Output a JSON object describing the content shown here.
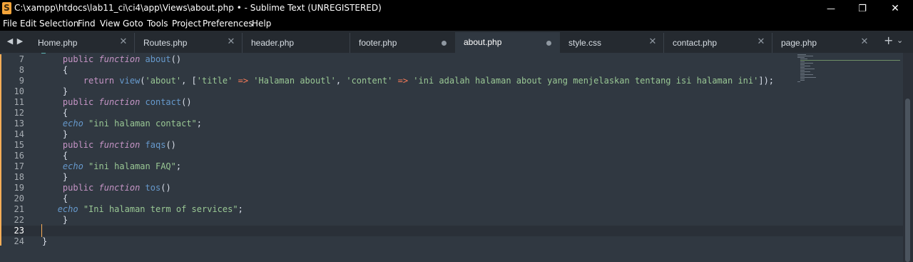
{
  "window": {
    "title": "C:\\xampp\\htdocs\\lab11_ci\\ci4\\app\\Views\\about.php • - Sublime Text (UNREGISTERED)",
    "app_icon": "sublime-text-icon",
    "controls": {
      "minimize": "—",
      "maximize": "❐",
      "close": "✕"
    }
  },
  "menu": [
    "File",
    "Edit",
    "Selection",
    "Find",
    "View",
    "Goto",
    "Tools",
    "Project",
    "Preferences",
    "Help"
  ],
  "tabs": [
    {
      "label": "Home.php",
      "state": "close",
      "active": false
    },
    {
      "label": "Routes.php",
      "state": "close",
      "active": false
    },
    {
      "label": "header.php",
      "state": "none",
      "active": false
    },
    {
      "label": "footer.php",
      "state": "dirty",
      "active": false
    },
    {
      "label": "about.php",
      "state": "dirty",
      "active": true
    },
    {
      "label": "style.css",
      "state": "close",
      "active": false
    },
    {
      "label": "contact.php",
      "state": "close",
      "active": false
    },
    {
      "label": "page.php",
      "state": "close",
      "active": false
    }
  ],
  "tab_icons": {
    "prev": "◀",
    "next": "▶",
    "close": "✕",
    "new_tab": "+",
    "tab_list": "⌄"
  },
  "editor": {
    "current_line": 23,
    "lines": [
      {
        "n": "7",
        "tokens": [
          [
            "    ",
            "pun"
          ],
          [
            "public",
            "kw"
          ],
          [
            " ",
            "pun"
          ],
          [
            "function",
            "fn"
          ],
          [
            " ",
            "pun"
          ],
          [
            "about",
            "name"
          ],
          [
            "()",
            "pun"
          ]
        ]
      },
      {
        "n": "8",
        "tokens": [
          [
            "    {",
            "pun"
          ]
        ]
      },
      {
        "n": "9",
        "tokens": [
          [
            "        ",
            "pun"
          ],
          [
            "return",
            "kw"
          ],
          [
            " ",
            "pun"
          ],
          [
            "view",
            "name"
          ],
          [
            "(",
            "pun"
          ],
          [
            "'about'",
            "str"
          ],
          [
            ", [",
            "pun"
          ],
          [
            "'title'",
            "str"
          ],
          [
            " ",
            "pun"
          ],
          [
            "=>",
            "op"
          ],
          [
            " ",
            "pun"
          ],
          [
            "'Halaman aboutl'",
            "str"
          ],
          [
            ", ",
            "pun"
          ],
          [
            "'content'",
            "str"
          ],
          [
            " ",
            "pun"
          ],
          [
            "=>",
            "op"
          ],
          [
            " ",
            "pun"
          ],
          [
            "'ini adalah halaman about yang menjelaskan tentang isi halaman ini'",
            "str"
          ],
          [
            "]);",
            "pun"
          ]
        ]
      },
      {
        "n": "10",
        "tokens": [
          [
            "    }",
            "pun"
          ]
        ]
      },
      {
        "n": "11",
        "tokens": [
          [
            "    ",
            "pun"
          ],
          [
            "public",
            "kw"
          ],
          [
            " ",
            "pun"
          ],
          [
            "function",
            "fn"
          ],
          [
            " ",
            "pun"
          ],
          [
            "contact",
            "name"
          ],
          [
            "()",
            "pun"
          ]
        ]
      },
      {
        "n": "12",
        "tokens": [
          [
            "    {",
            "pun"
          ]
        ]
      },
      {
        "n": "13",
        "tokens": [
          [
            "    ",
            "pun"
          ],
          [
            "echo",
            "echo"
          ],
          [
            " ",
            "pun"
          ],
          [
            "\"ini halaman contact\"",
            "str"
          ],
          [
            ";",
            "pun"
          ]
        ]
      },
      {
        "n": "14",
        "tokens": [
          [
            "    }",
            "pun"
          ]
        ]
      },
      {
        "n": "15",
        "tokens": [
          [
            "    ",
            "pun"
          ],
          [
            "public",
            "kw"
          ],
          [
            " ",
            "pun"
          ],
          [
            "function",
            "fn"
          ],
          [
            " ",
            "pun"
          ],
          [
            "faqs",
            "name"
          ],
          [
            "()",
            "pun"
          ]
        ]
      },
      {
        "n": "16",
        "tokens": [
          [
            "    {",
            "pun"
          ]
        ]
      },
      {
        "n": "17",
        "tokens": [
          [
            "    ",
            "pun"
          ],
          [
            "echo",
            "echo"
          ],
          [
            " ",
            "pun"
          ],
          [
            "\"ini halaman FAQ\"",
            "str"
          ],
          [
            ";",
            "pun"
          ]
        ]
      },
      {
        "n": "18",
        "tokens": [
          [
            "    }",
            "pun"
          ]
        ]
      },
      {
        "n": "19",
        "tokens": [
          [
            "    ",
            "pun"
          ],
          [
            "public",
            "kw"
          ],
          [
            " ",
            "pun"
          ],
          [
            "function",
            "fn"
          ],
          [
            " ",
            "pun"
          ],
          [
            "tos",
            "name"
          ],
          [
            "()",
            "pun"
          ]
        ]
      },
      {
        "n": "20",
        "tokens": [
          [
            "    {",
            "pun"
          ]
        ]
      },
      {
        "n": "21",
        "tokens": [
          [
            "   ",
            "pun"
          ],
          [
            "echo",
            "echo"
          ],
          [
            " ",
            "pun"
          ],
          [
            "\"Ini halaman term of services\"",
            "str"
          ],
          [
            ";",
            "pun"
          ]
        ]
      },
      {
        "n": "22",
        "tokens": [
          [
            "    }",
            "pun"
          ]
        ]
      },
      {
        "n": "23",
        "tokens": [
          [
            "",
            "pun"
          ]
        ]
      },
      {
        "n": "24",
        "tokens": [
          [
            "}",
            "pun"
          ]
        ]
      }
    ]
  },
  "colors": {
    "background": "#303841",
    "keyword": "#c594c5",
    "function_name": "#6699cc",
    "string": "#99c794",
    "operator": "#f97b58",
    "modified_marker": "#f9ae58"
  }
}
